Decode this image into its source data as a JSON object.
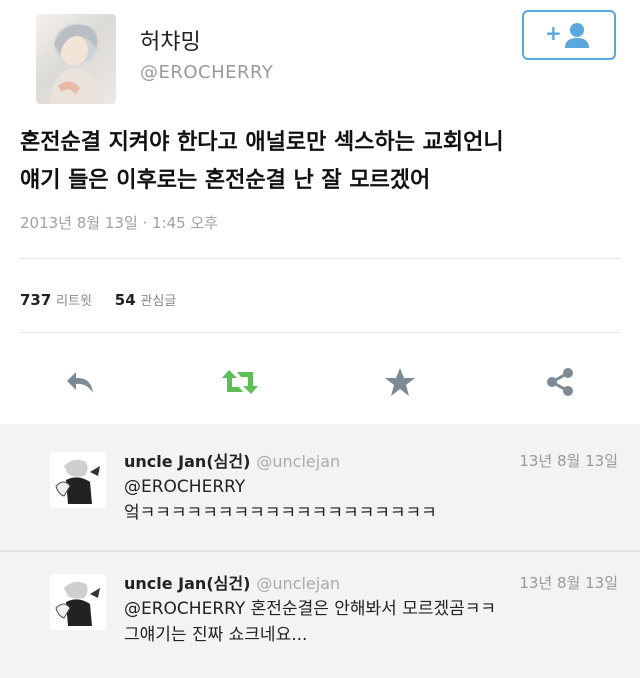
{
  "tweet": {
    "author_name": "허챠밍",
    "author_handle": "@EROCHERRY",
    "follow_label": "+",
    "text_line1": "혼전순결 지켜야 한다고 애널로만 섹스하는 교회언니",
    "text_line2": "얘기 들은 이후로는 혼전순결 난 잘 모르겠어",
    "timestamp": "2013년 8월 13일 · 1:45 오후",
    "retweet_count": "737",
    "retweet_label": "리트윗",
    "favorite_count": "54",
    "favorite_label": "관심글"
  },
  "actions": {
    "reply_icon": "reply-icon",
    "retweet_icon": "retweet-icon",
    "favorite_icon": "star-icon",
    "share_icon": "share-icon"
  },
  "replies": [
    {
      "name": "uncle Jan(심건)",
      "handle": "@unclejan",
      "date": "13년 8월 13일",
      "line1": "@EROCHERRY",
      "line2": "엌ㅋㅋㅋㅋㅋㅋㅋㅋㅋㅋㅋㅋㅋㅋㅋㅋㅋㅋㅋ"
    },
    {
      "name": "uncle Jan(심건)",
      "handle": "@unclejan",
      "date": "13년 8월 13일",
      "line1": "@EROCHERRY 혼전순결은 안해봐서 모르겠곰ㅋㅋ",
      "line2": "그얘기는 진짜 쇼크네요..."
    }
  ],
  "colors": {
    "accent": "#5aa7de",
    "retweet_green": "#5bbf55",
    "icon_gray": "#7d8a94"
  }
}
